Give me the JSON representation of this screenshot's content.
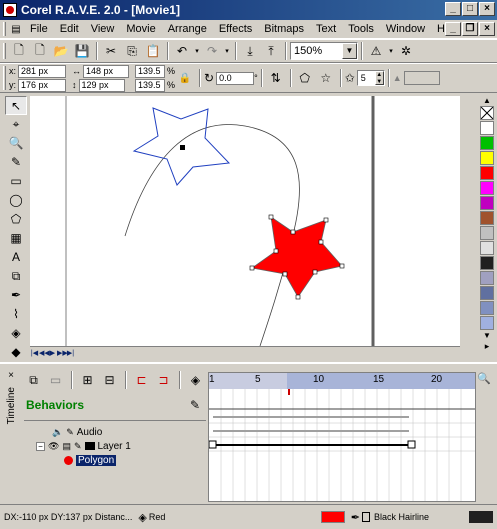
{
  "window": {
    "title": "Corel R.A.V.E. 2.0 - [Movie1]"
  },
  "menu": [
    "File",
    "Edit",
    "View",
    "Movie",
    "Arrange",
    "Effects",
    "Bitmaps",
    "Text",
    "Tools",
    "Window",
    "Help"
  ],
  "toolbar": {
    "zoom": "150%"
  },
  "properties": {
    "x": "281 px",
    "y": "176 px",
    "width": "148 px",
    "height": "129 px",
    "scale_x": "139.5",
    "scale_y": "139.5",
    "scale_unit": "%",
    "rotation": "0.0",
    "rotation_unit": "°",
    "points": "5"
  },
  "timeline": {
    "side_label": "Timeline",
    "behaviors_label": "Behaviors",
    "ruler_ticks": [
      "1",
      "5",
      "10",
      "15",
      "20"
    ],
    "layers": [
      {
        "name": "Audio"
      },
      {
        "name": "Layer 1"
      },
      {
        "name": "Polygon"
      }
    ]
  },
  "status": {
    "coords": "DX:-110 px DY:137 px Distanc...",
    "fill_label": "Red",
    "outline_label": "Black  Hairline"
  },
  "colors": {
    "fill": "#ff0000",
    "title": "#0a246a",
    "selection": "#0a246a"
  },
  "palette": [
    "#ffffff",
    "#00c000",
    "#ffff00",
    "#ff0000",
    "#ff00ff",
    "#c000c0",
    "#a0522d",
    "#c0c0c0",
    "#e0e0e0",
    "#202020",
    "#a0a0c0",
    "#6070a0",
    "#8090c0",
    "#a0b0e0"
  ]
}
